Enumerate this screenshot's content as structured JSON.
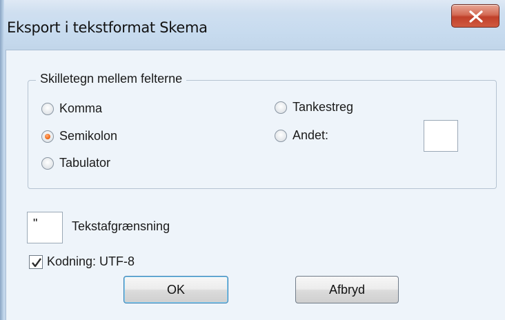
{
  "window": {
    "title": "Eksport i tekstformat Skema",
    "close_icon": "close-icon"
  },
  "separator_group": {
    "legend": "Skilletegn mellem felterne",
    "options": [
      {
        "label": "Komma",
        "checked": false
      },
      {
        "label": "Semikolon",
        "checked": true
      },
      {
        "label": "Tabulator",
        "checked": false
      },
      {
        "label": "Tankestreg",
        "checked": false
      },
      {
        "label": "Andet:",
        "checked": false
      }
    ],
    "other_value": ""
  },
  "text_delimiter": {
    "value": "\"",
    "label": "Tekstafgrænsning"
  },
  "encoding": {
    "label": "Kodning: UTF-8",
    "checked": true
  },
  "buttons": {
    "ok_label": "OK",
    "cancel_label": "Afbryd"
  },
  "colors": {
    "radio_accent": "#f06a1a",
    "close_button": "#c0402a",
    "ok_focus": "#3c7fb1"
  }
}
